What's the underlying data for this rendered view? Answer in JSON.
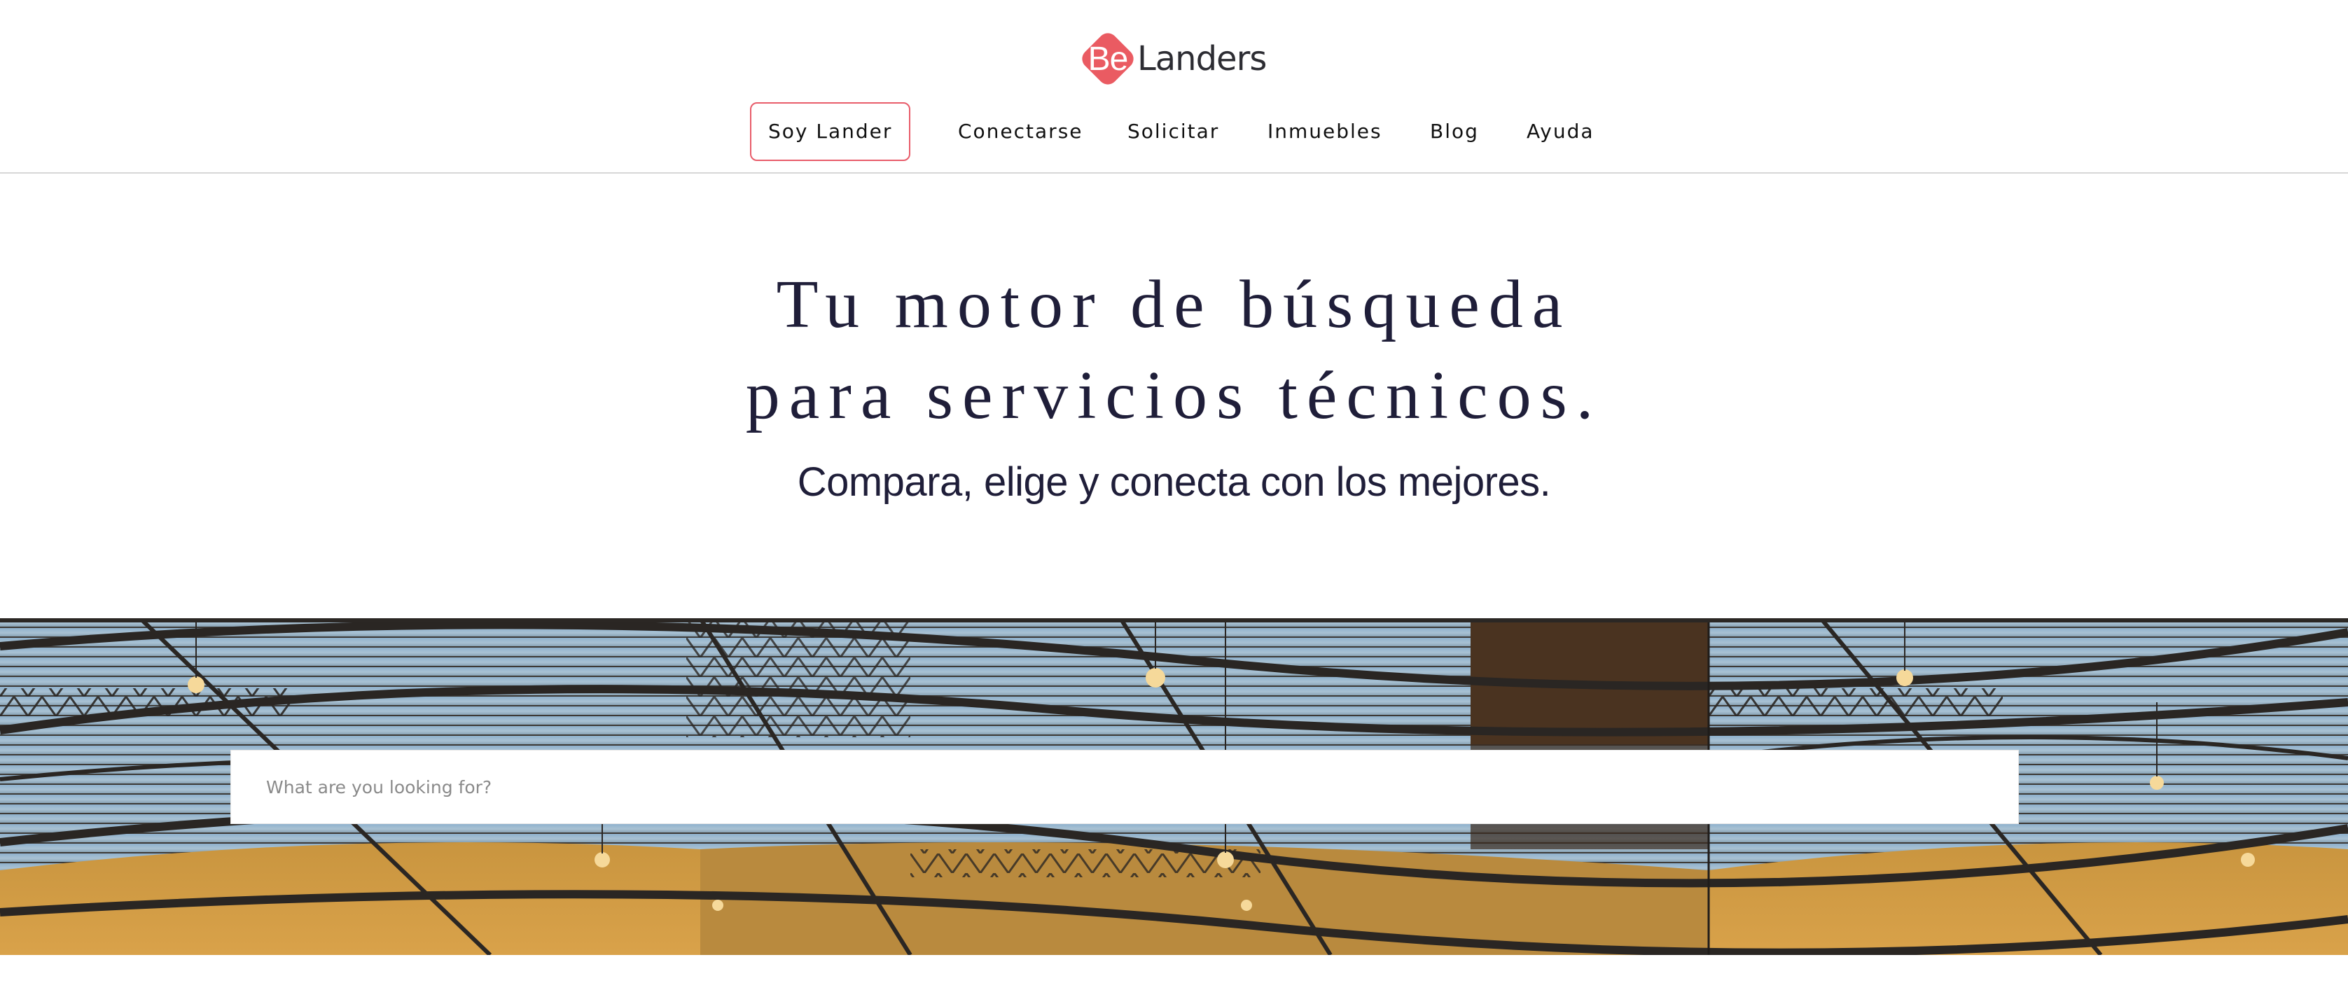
{
  "brand": {
    "mark": "Be",
    "name": "Landers",
    "accent": "#ea5b62"
  },
  "nav": {
    "items": [
      {
        "label": "Soy Lander",
        "style": "outlined"
      },
      {
        "label": "Conectarse"
      },
      {
        "label": "Solicitar"
      },
      {
        "label": "Inmuebles"
      },
      {
        "label": "Blog"
      },
      {
        "label": "Ayuda"
      }
    ]
  },
  "hero": {
    "title_line_1": "Tu motor de búsqueda",
    "title_line_2": "para servicios técnicos.",
    "subtitle": "Compara, elige y conecta con los mejores."
  },
  "search": {
    "placeholder": "What are you looking for?",
    "value": ""
  },
  "colors": {
    "heading": "#1f1e39",
    "divider": "#d7d7d7"
  }
}
